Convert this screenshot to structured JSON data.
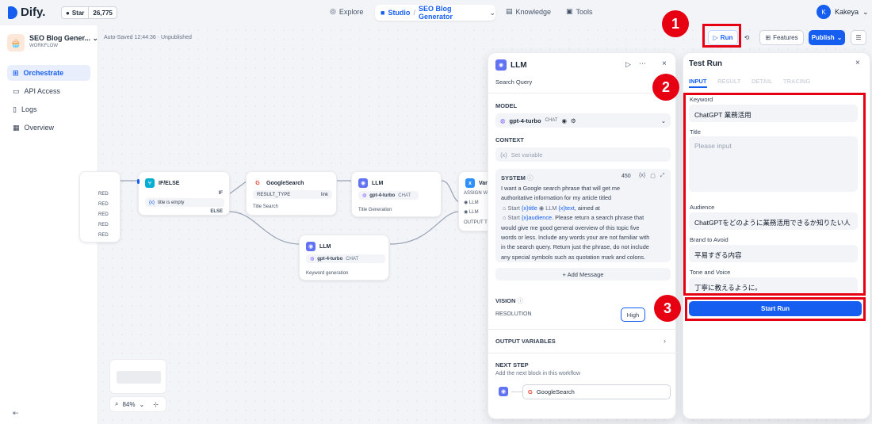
{
  "brand": {
    "name": "Dify.",
    "star_label": "Star",
    "star_count": "26,775"
  },
  "topnav": {
    "explore": "Explore",
    "studio": "Studio",
    "separator": "/",
    "app_name": "SEO Blog Generator",
    "knowledge": "Knowledge",
    "tools": "Tools",
    "user_initial": "K",
    "user_name": "Kakeya"
  },
  "sidebar": {
    "app_name": "SEO Blog Gener...",
    "app_type": "WORKFLOW",
    "items": [
      {
        "label": "Orchestrate",
        "active": true
      },
      {
        "label": "API Access"
      },
      {
        "label": "Logs"
      },
      {
        "label": "Overview"
      }
    ]
  },
  "toolbar": {
    "autosave": "Auto-Saved 12:44:36 · Unpublished",
    "run": "Run",
    "features": "Features",
    "publish": "Publish"
  },
  "annotations": [
    "1",
    "2",
    "3"
  ],
  "canvas": {
    "start_rows": [
      "RED",
      "RED",
      "RED",
      "RED",
      "RED"
    ],
    "ifelse": {
      "title": "IF/ELSE",
      "if": "IF",
      "cond": "title is empty",
      "else": "ELSE"
    },
    "google": {
      "title": "GoogleSearch",
      "key": "RESULT_TYPE",
      "val": "link",
      "desc": "Title Search"
    },
    "llm1": {
      "title": "LLM",
      "model": "gpt-4-turbo",
      "tag": "CHAT",
      "desc": "Title Generation"
    },
    "llm2": {
      "title": "LLM",
      "model": "gpt-4-turbo",
      "tag": "CHAT",
      "desc": "Keyword generation"
    },
    "variable": {
      "title": "Varia",
      "assign": "ASSIGN VA",
      "row1": "LLM",
      "row2": "LLM",
      "output": "OUTPUT T"
    },
    "zoom": "84%"
  },
  "llm_panel": {
    "title": "LLM",
    "subtitle": "Search Query",
    "model_label": "MODEL",
    "model_name": "gpt-4-turbo",
    "model_tag": "CHAT",
    "context_label": "CONTEXT",
    "context_placeholder": "Set variable",
    "system_label": "SYSTEM",
    "system_count": "450",
    "system_lines": [
      "I want a Google search phrase that will get me",
      "authoritative information for my article titled",
      "Please return a search phrase that",
      "would give me good general overview of this topic five",
      "words or less. Include any words your are not familiar with",
      "in the search query. Return just the phrase, do not include",
      "any special symbols such as quotation mark and colons."
    ],
    "tokens": {
      "start": "Start",
      "title": "title",
      "llm": "LLM",
      "text": "text",
      "aimed_at": ", aimed at",
      "audience": "audience",
      "period": "."
    },
    "add_message": "+ Add Message",
    "vision_label": "VISION",
    "resolution_label": "RESOLUTION",
    "resolution_value": "High",
    "output_vars": "OUTPUT VARIABLES",
    "next_step": "NEXT STEP",
    "next_step_hint": "Add the next block in this workflow",
    "next_node": "GoogleSearch"
  },
  "test_run": {
    "title": "Test Run",
    "tabs": [
      "INPUT",
      "RESULT",
      "DETAIL",
      "TRACING"
    ],
    "fields": [
      {
        "label": "Keyword",
        "value": "ChatGPT 業務活用"
      },
      {
        "label": "Title",
        "placeholder": "Please input"
      },
      {
        "label": "Audience",
        "value": "ChatGPTをどのように業務活用できるか知りたい人"
      },
      {
        "label": "Brand to Avoid",
        "value": "平易すぎる内容"
      },
      {
        "label": "Tone and Voice",
        "value": "丁寧に教えるように。"
      }
    ],
    "start": "Start Run"
  }
}
